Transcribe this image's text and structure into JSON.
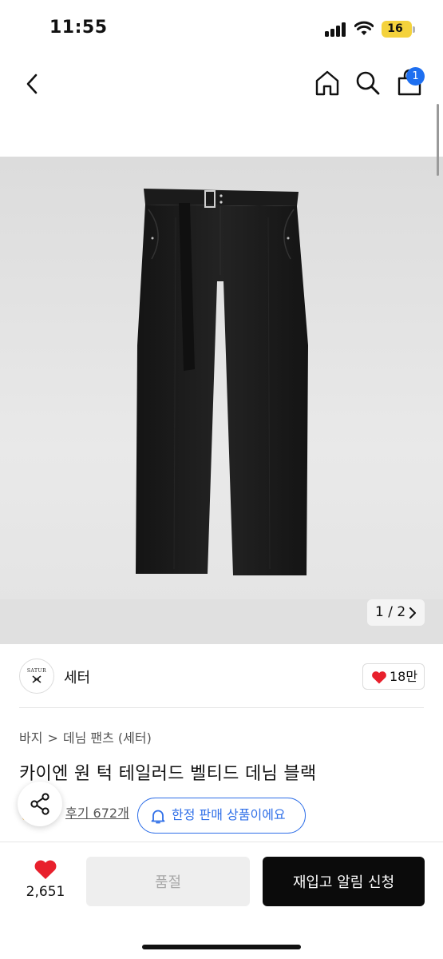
{
  "status_bar": {
    "time": "11:55",
    "battery": "16",
    "icons": [
      "signal-icon",
      "wifi-icon",
      "battery-icon"
    ]
  },
  "top_nav": {
    "icons": [
      "back-chevron-icon",
      "home-icon",
      "search-icon",
      "shopping-bag-icon"
    ],
    "cart_badge": "1",
    "badge_color": "#1e6ff0"
  },
  "gallery": {
    "pager": "1 / 2",
    "image": "black belted denim pants"
  },
  "brand": {
    "logo_text": "SATUR",
    "name": "세터",
    "like_count": "18만"
  },
  "breadcrumb": {
    "items": [
      "바지",
      "데님 팬츠 (세터)"
    ],
    "separator": ">"
  },
  "product": {
    "title": "카이엔 원 턱 테일러드 벨티드 데님 블랙"
  },
  "review": {
    "label": "후기 672개"
  },
  "limited_badge": {
    "label": "한정 판매 상품이에요",
    "color": "#2f6fe8"
  },
  "bottom_bar": {
    "wish_count": "2,651",
    "soldout_label": "품절",
    "restock_label": "재입고 알림 신청",
    "heart_color": "#e8202c"
  }
}
